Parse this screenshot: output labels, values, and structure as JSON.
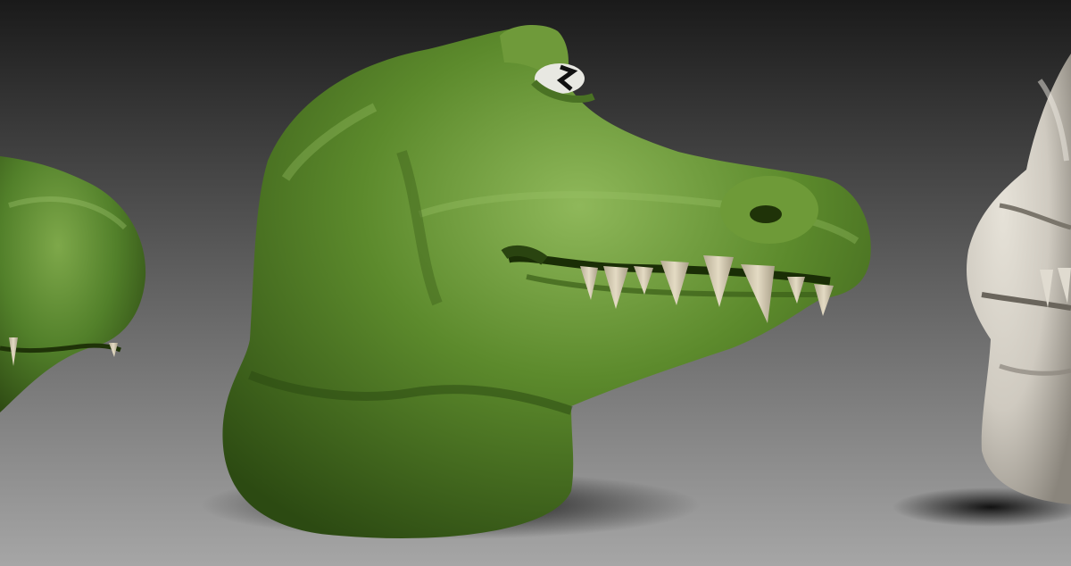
{
  "scene": {
    "subject": "croc-head-sculpt",
    "models": [
      "croc-head-left-partial",
      "croc-head-center",
      "croc-head-right-clay"
    ],
    "colors": {
      "background_top": "#1a1a1a",
      "background_bottom": "#a6a6a6",
      "skin_base": "#5c8a2c",
      "skin_shadow": "#2c4a12",
      "skin_highlight": "#8fb85a",
      "tooth": "#d9cfb6",
      "eye_white": "#e8e8e2",
      "pupil": "#111111",
      "clay": "#cfcac0",
      "clay_shadow": "#8a857c",
      "floor_shadow": "#0a0a0a"
    }
  }
}
